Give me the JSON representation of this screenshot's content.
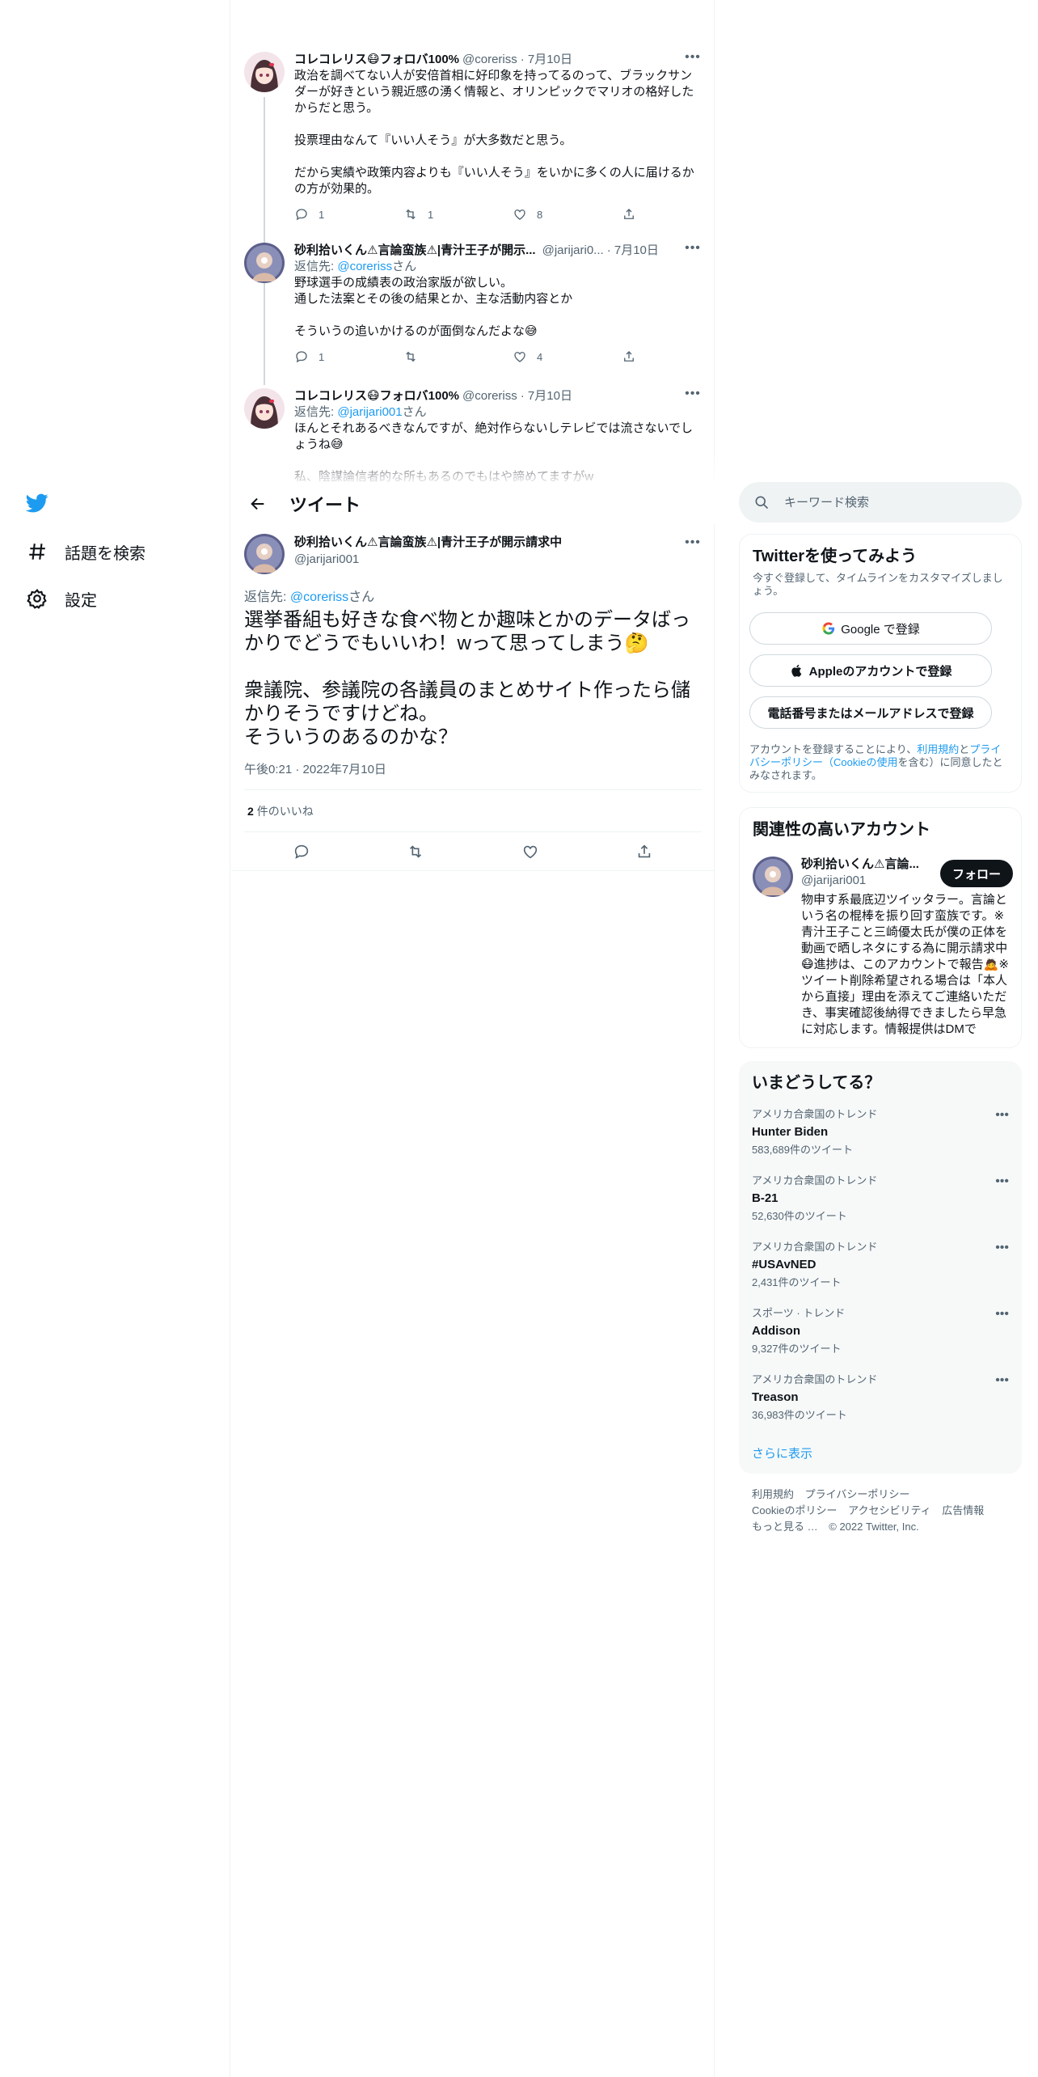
{
  "nav": {
    "explore_label": "話題を検索",
    "settings_label": "設定"
  },
  "thread": [
    {
      "name": "コレコレリス😷フォロバ100%",
      "handle": "@coreriss",
      "date": "· 7月10日",
      "reply_prefix": "",
      "reply_to": "",
      "reply_suffix": "",
      "text": "政治を調べてない人が安倍首相に好印象を持ってるのって、ブラックサンダーが好きという親近感の湧く情報と、オリンピックでマリオの格好したからだと思う。\n\n投票理由なんて『いい人そう』が大多数だと思う。\n\nだから実績や政策内容よりも『いい人そう』をいかに多くの人に届けるかの方が効果的。",
      "replies": "1",
      "retweets": "1",
      "likes": "8"
    },
    {
      "name": "砂利拾いくん⚠言論蛮族⚠|青汁王子が開示...",
      "handle": "@jarijari0...",
      "date": "· 7月10日",
      "reply_prefix": "返信先: ",
      "reply_to": "@coreriss",
      "reply_suffix": "さん",
      "text": "野球選手の成績表の政治家版が欲しい。\n通した法案とその後の結果とか、主な活動内容とか\n\nそういうの追いかけるのが面倒なんだよな😅",
      "replies": "1",
      "retweets": "",
      "likes": "4"
    },
    {
      "name": "コレコレリス😷フォロバ100%",
      "handle": "@coreriss",
      "date": "· 7月10日",
      "reply_prefix": "返信先: ",
      "reply_to": "@jarijari001",
      "reply_suffix": "さん",
      "text": "ほんとそれあるべきなんですが、絶対作らないしテレビでは流さないでしょうね😅\n\n私、陰謀論信者的な所もあるのでもはや諦めてますがw",
      "replies": "",
      "retweets": "",
      "likes": ""
    }
  ],
  "header": {
    "title": "ツイート"
  },
  "main_tweet": {
    "name": "砂利拾いくん⚠言論蛮族⚠|青汁王子が開示請求中",
    "handle": "@jarijari001",
    "reply_prefix": "返信先: ",
    "reply_to": "@coreriss",
    "reply_suffix": "さん",
    "text": "選挙番組も好きな食べ物とか趣味とかのデータばっかりでどうでもいいわ！wって思ってしまう🤔\n\n衆議院、参議院の各議員のまとめサイト作ったら儲かりそうですけどね。\nそういうのあるのかな？",
    "timestamp": "午後0:21 · 2022年7月10日",
    "like_count": "2",
    "like_label": "件のいいね"
  },
  "search": {
    "placeholder": "キーワード検索"
  },
  "signup": {
    "title": "Twitterを使ってみよう",
    "desc": "今すぐ登録して、タイムラインをカスタマイズしましょう。",
    "google": "Google で登録",
    "apple": "Appleのアカウントで登録",
    "phone": "電話番号またはメールアドレスで登録",
    "terms_a": "アカウントを登録することにより、",
    "terms_link1": "利用規約",
    "terms_b": "と",
    "terms_link2": "プライバシーポリシー（Cookieの使用",
    "terms_c": "を含む）に同意したとみなされます。"
  },
  "relevant": {
    "title": "関連性の高いアカウント",
    "name": "砂利拾いくん⚠言論...",
    "handle": "@jarijari001",
    "follow": "フォロー",
    "bio": "物申す系最底辺ツイッタラー。言論という名の棍棒を振り回す蛮族です。※青汁王子こと三崎優太氏が僕の正体を動画で晒しネタにする為に開示請求中😷進捗は、このアカウントで報告🙇※ツイート削除希望される場合は「本人から直接」理由を添えてご連絡いただき、事実確認後納得できましたら早急に対応します。情報提供はDMで"
  },
  "trends": {
    "title": "いまどうしてる？",
    "items": [
      {
        "context": "アメリカ合衆国のトレンド",
        "name": "Hunter Biden",
        "count": "583,689件のツイート"
      },
      {
        "context": "アメリカ合衆国のトレンド",
        "name": "B-21",
        "count": "52,630件のツイート"
      },
      {
        "context": "アメリカ合衆国のトレンド",
        "name": "#USAvNED",
        "count": "2,431件のツイート"
      },
      {
        "context": "スポーツ · トレンド",
        "name": "Addison",
        "count": "9,327件のツイート"
      },
      {
        "context": "アメリカ合衆国のトレンド",
        "name": "Treason",
        "count": "36,983件のツイート"
      }
    ],
    "show_more": "さらに表示"
  },
  "footer": {
    "links": [
      "利用規約",
      "プライバシーポリシー",
      "Cookieのポリシー",
      "アクセシビリティ",
      "広告情報",
      "もっと見る …"
    ],
    "copyright": "© 2022 Twitter, Inc."
  },
  "colors": {
    "accent": "#1d9bf0",
    "text": "#0f1419",
    "muted": "#536471"
  }
}
